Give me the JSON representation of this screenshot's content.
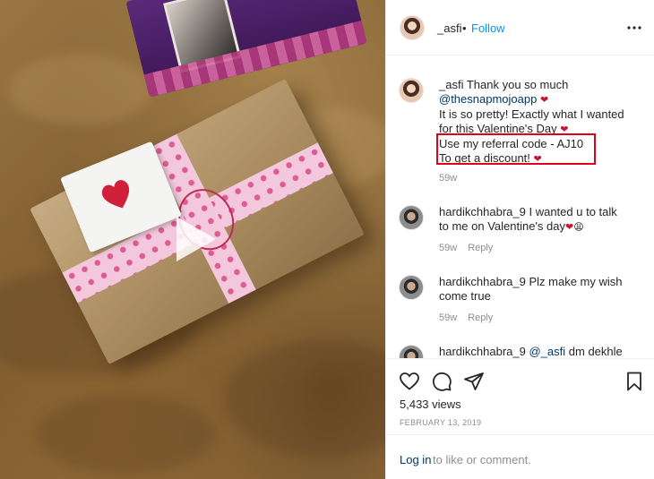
{
  "post": {
    "username": "_asfi",
    "separator": "•",
    "follow_label": "Follow",
    "more_icon": "more-horizontal-icon"
  },
  "comments": [
    {
      "username": "_asfi",
      "lines": [
        "Thank you so much",
        "@thesnapmojoapp",
        "It is so pretty! Exactly what I wanted",
        "for this Valentine's Day",
        "Use my referral code - AJ10",
        "To get a discount!"
      ],
      "time": "59w",
      "highlighted_lines": [
        "Use my referral code - AJ10",
        "To get a discount!"
      ]
    },
    {
      "username": "hardikchhabra_9",
      "line1": "I wanted u to talk",
      "line2": "to me on Valentine's day",
      "time": "59w",
      "reply": "Reply"
    },
    {
      "username": "hardikchhabra_9",
      "line1": "Plz make my wish",
      "line2": "come true",
      "time": "59w",
      "reply": "Reply"
    },
    {
      "username": "hardikchhabra_9",
      "mention": "@_asfi",
      "line1": "dm dekhle"
    }
  ],
  "actions": {
    "like_icon": "heart-outline-icon",
    "comment_icon": "comment-bubble-icon",
    "share_icon": "paper-plane-icon",
    "save_icon": "bookmark-icon",
    "views": "5,433 views",
    "date": "FEBRUARY 13, 2019"
  },
  "login": {
    "link": "Log in",
    "rest": "to like or comment."
  },
  "colors": {
    "link_blue": "#0095f6",
    "mention_navy": "#00376b",
    "highlight_red": "#e0001a",
    "heart_red": "#c91434",
    "muted": "#8e8e8e"
  }
}
